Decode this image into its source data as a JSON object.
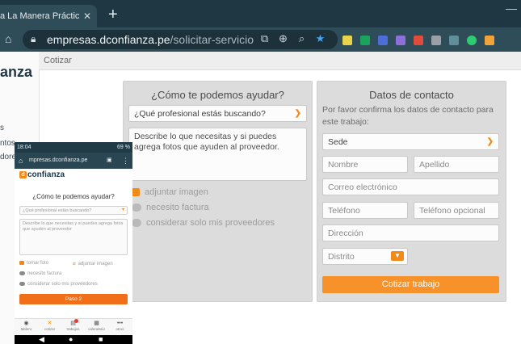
{
  "browser": {
    "tab_title": "a La Manera Práctica De",
    "tab_close": "✕",
    "new_tab": "+",
    "minimize": "—",
    "url_host": "empresas.dconfianza.pe",
    "url_path": "/solicitar-servicio",
    "icons": [
      "home-icon",
      "lock-icon",
      "open-in-app-icon",
      "zoom-in-icon",
      "search-icon",
      "star-icon"
    ],
    "extension_colors": [
      "#e8d34a",
      "#1aa35b",
      "#4c6ed6",
      "#8c6fd8",
      "#e04b3a",
      "#9aa0a6",
      "#5f8f9b",
      "#2ecc71",
      "#f2a33a"
    ]
  },
  "site": {
    "brand_tail": "anza",
    "sidebar_fragments": [
      "s",
      "ntos",
      "dores"
    ],
    "breadcrumb": "Cotizar",
    "help_card": {
      "title": "¿Cómo te podemos ayudar?",
      "professional_select": "¿Qué profesional estás buscando?",
      "description_placeholder": "Describe lo que necesitas y si puedes agrega fotos que ayuden al proveedor.",
      "options": [
        "adjuntar imagen",
        "necesito factura",
        "considerar solo mis proveedores"
      ]
    },
    "contact_card": {
      "title": "Datos de contacto",
      "instructions": "Por favor confirma los datos de contacto para este trabajo:",
      "sede": "Sede",
      "nombre": "Nombre",
      "apellido": "Apellido",
      "correo": "Correo electrónico",
      "telefono": "Teléfono",
      "telefono_opcional": "Teléfono opcional",
      "direccion": "Dirección",
      "distrito": "Distrito",
      "submit": "Cotizar trabajo"
    }
  },
  "phone": {
    "time": "18:04",
    "status_right": "69 %",
    "url": "mpresas.dconfianza.pe",
    "logo_letter": "d",
    "logo_text": "confianza",
    "title": "¿Cómo te podemos ayudar?",
    "professional_select": "¿Qué profesional estás buscando?",
    "description_placeholder": "Describe lo que necesitas y si puedes agrega fotos que ayuden al proveedor",
    "tomar_foto": "tomar foto",
    "adjuntar_imagen": "adjuntar imagen",
    "necesito_factura": "necesito factura",
    "considerar": "considerar solo mis proveedores",
    "next_button": "Paso 2",
    "nav": [
      {
        "label": "tablero",
        "icon": "dashboard-icon"
      },
      {
        "label": "cotizar",
        "icon": "tools-icon"
      },
      {
        "label": "trabajos",
        "icon": "briefcase-icon"
      },
      {
        "label": "calendario",
        "icon": "calendar-icon"
      },
      {
        "label": "otros",
        "icon": "more-icon"
      }
    ]
  }
}
